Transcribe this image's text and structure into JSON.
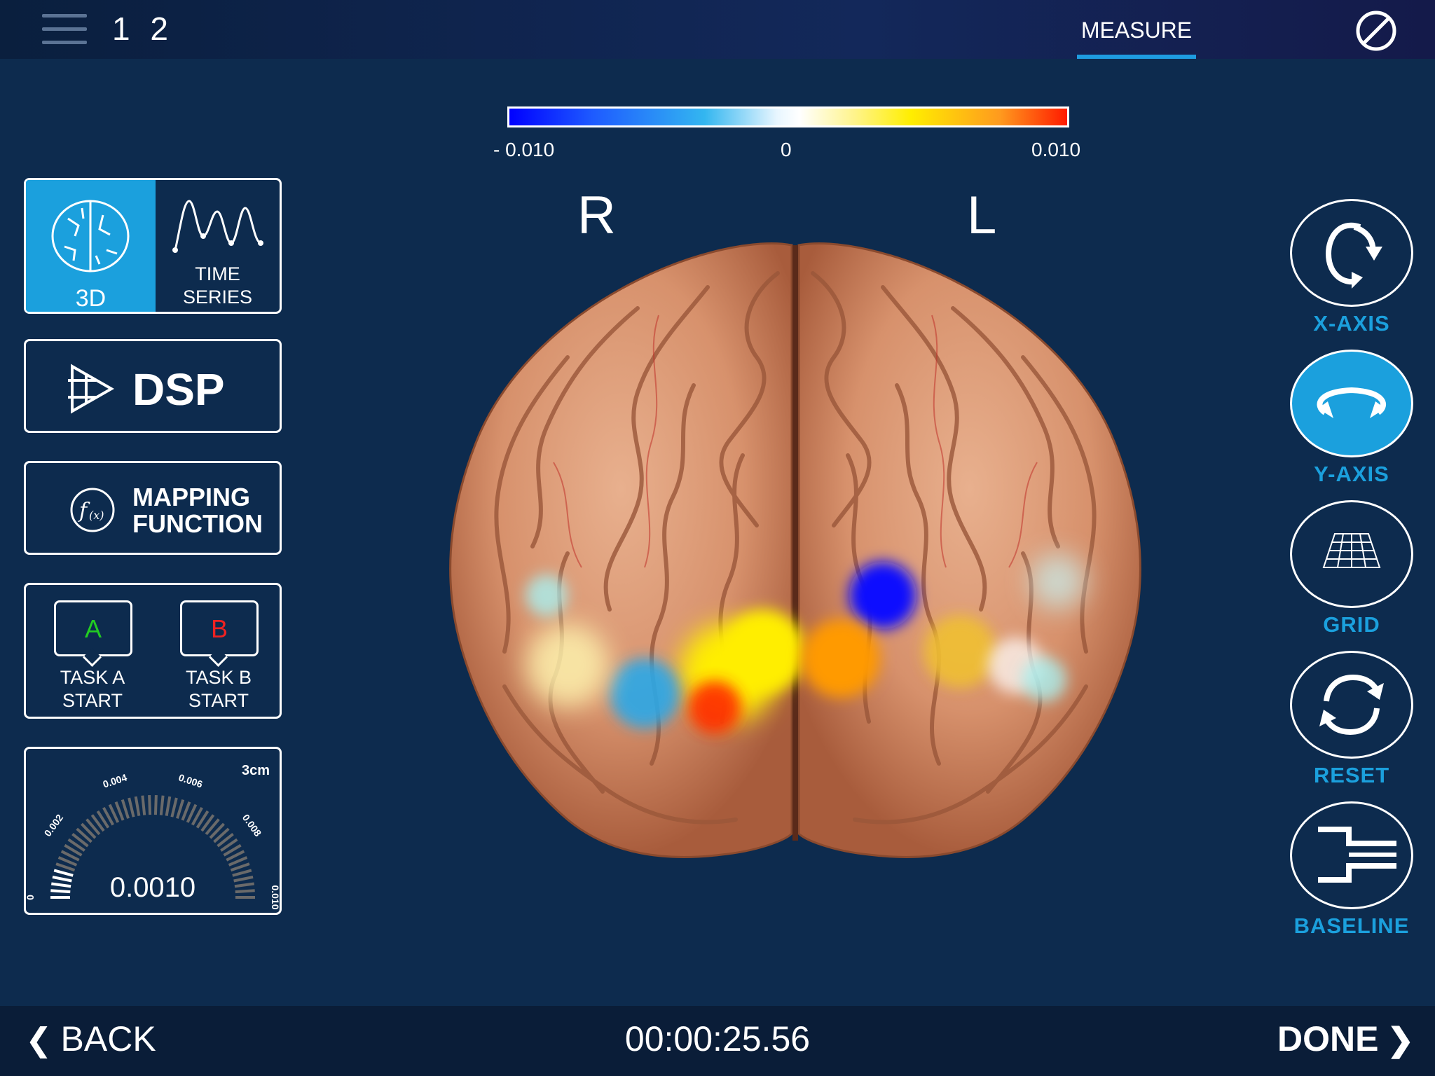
{
  "header": {
    "session_number": "1 2",
    "tabs": [
      {
        "label": "MEASURE",
        "active": true
      }
    ],
    "icons": [
      "menu-icon",
      "stop-icon"
    ]
  },
  "colorbar": {
    "min_label": "- 0.010",
    "mid_label": "0",
    "max_label": "0.010",
    "colors": [
      "#0000ff",
      "#33b6f0",
      "#ffffff",
      "#ffee00",
      "#ff1a00"
    ]
  },
  "brain_view": {
    "right_label": "R",
    "left_label": "L"
  },
  "left_panel": {
    "view_3d_label": "3D",
    "time_series_label": "TIME\nSERIES",
    "dsp_label": "DSP",
    "mapping_label_line1": "MAPPING",
    "mapping_label_line2": "FUNCTION",
    "task_a": {
      "letter": "A",
      "label": "TASK A\nSTART",
      "color": "#22cc22"
    },
    "task_b": {
      "letter": "B",
      "label": "TASK B\nSTART",
      "color": "#ee2222"
    },
    "gauge": {
      "value": "0.0010",
      "unit": "3cm",
      "ticks": [
        "0",
        "0.002",
        "0.004",
        "0.006",
        "0.008",
        "0.010"
      ],
      "level": 0.1
    }
  },
  "right_panel": {
    "x_axis": "X-AXIS",
    "y_axis": "Y-AXIS",
    "grid": "GRID",
    "reset": "RESET",
    "baseline": "BASELINE",
    "active": "Y-AXIS"
  },
  "footer": {
    "back_label": "BACK",
    "timer": "00:00:25.56",
    "done_label": "DONE"
  },
  "accent_color": "#1ba0dd"
}
